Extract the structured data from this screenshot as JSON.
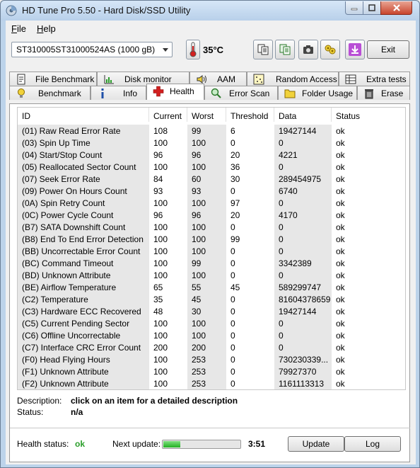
{
  "window": {
    "title": "HD Tune Pro 5.50 - Hard Disk/SSD Utility",
    "icon": "disk-app-icon"
  },
  "menu": [
    {
      "label": "File"
    },
    {
      "label": "Help"
    }
  ],
  "toolbar": {
    "drive": "ST310005ST31000524AS (1000 gB)",
    "temperature": "35",
    "temperature_unit": "°C",
    "buttons": [
      "copy-text-icon",
      "copy-info-icon",
      "screenshot-icon",
      "options-icon",
      "save-download-icon"
    ],
    "exit_label": "Exit"
  },
  "tabs_top": [
    {
      "label": "File Benchmark",
      "icon": "file-benchmark-icon"
    },
    {
      "label": "Disk monitor",
      "icon": "disk-monitor-icon"
    },
    {
      "label": "AAM",
      "icon": "speaker-icon"
    },
    {
      "label": "Random Access",
      "icon": "random-access-icon"
    },
    {
      "label": "Extra tests",
      "icon": "extra-tests-icon"
    }
  ],
  "tabs_bottom": [
    {
      "label": "Benchmark",
      "icon": "lightbulb-icon"
    },
    {
      "label": "Info",
      "icon": "info-icon"
    },
    {
      "label": "Health",
      "icon": "health-cross-icon"
    },
    {
      "label": "Error Scan",
      "icon": "magnifier-icon"
    },
    {
      "label": "Folder Usage",
      "icon": "folder-icon"
    },
    {
      "label": "Erase",
      "icon": "trash-icon"
    }
  ],
  "active_tab": "Health",
  "table": {
    "headers": [
      "ID",
      "Current",
      "Worst",
      "Threshold",
      "Data",
      "Status"
    ],
    "rows": [
      [
        "(01) Raw Read Error Rate",
        "108",
        "99",
        "6",
        "19427144",
        "ok"
      ],
      [
        "(03) Spin Up Time",
        "100",
        "100",
        "0",
        "0",
        "ok"
      ],
      [
        "(04) Start/Stop Count",
        "96",
        "96",
        "20",
        "4221",
        "ok"
      ],
      [
        "(05) Reallocated Sector Count",
        "100",
        "100",
        "36",
        "0",
        "ok"
      ],
      [
        "(07) Seek Error Rate",
        "84",
        "60",
        "30",
        "289454975",
        "ok"
      ],
      [
        "(09) Power On Hours Count",
        "93",
        "93",
        "0",
        "6740",
        "ok"
      ],
      [
        "(0A) Spin Retry Count",
        "100",
        "100",
        "97",
        "0",
        "ok"
      ],
      [
        "(0C) Power Cycle Count",
        "96",
        "96",
        "20",
        "4170",
        "ok"
      ],
      [
        "(B7) SATA Downshift Count",
        "100",
        "100",
        "0",
        "0",
        "ok"
      ],
      [
        "(B8) End To End Error Detection",
        "100",
        "100",
        "99",
        "0",
        "ok"
      ],
      [
        "(BB) Uncorrectable Error Count",
        "100",
        "100",
        "0",
        "0",
        "ok"
      ],
      [
        "(BC) Command Timeout",
        "100",
        "99",
        "0",
        "3342389",
        "ok"
      ],
      [
        "(BD) Unknown Attribute",
        "100",
        "100",
        "0",
        "0",
        "ok"
      ],
      [
        "(BE) Airflow Temperature",
        "65",
        "55",
        "45",
        "589299747",
        "ok"
      ],
      [
        "(C2) Temperature",
        "35",
        "45",
        "0",
        "81604378659",
        "ok"
      ],
      [
        "(C3) Hardware ECC Recovered",
        "48",
        "30",
        "0",
        "19427144",
        "ok"
      ],
      [
        "(C5) Current Pending Sector",
        "100",
        "100",
        "0",
        "0",
        "ok"
      ],
      [
        "(C6) Offline Uncorrectable",
        "100",
        "100",
        "0",
        "0",
        "ok"
      ],
      [
        "(C7) Interface CRC Error Count",
        "200",
        "200",
        "0",
        "0",
        "ok"
      ],
      [
        "(F0) Head Flying Hours",
        "100",
        "253",
        "0",
        "730230339...",
        "ok"
      ],
      [
        "(F1) Unknown Attribute",
        "100",
        "253",
        "0",
        "79927370",
        "ok"
      ],
      [
        "(F2) Unknown Attribute",
        "100",
        "253",
        "0",
        "1161113313",
        "ok"
      ]
    ]
  },
  "description": {
    "label": "Description:",
    "value": "click on an item for a detailed description",
    "status_label": "Status:",
    "status_value": "n/a"
  },
  "footer": {
    "health_label": "Health status:",
    "health_value": "ok",
    "next_update_label": "Next update:",
    "next_update_progress": 0.22,
    "next_update_time": "3:51",
    "update_label": "Update",
    "log_label": "Log"
  },
  "colors": {
    "ok_green": "#2a9e2a",
    "progress_green": "#22b022",
    "health_red": "#d21f1f",
    "purple_button": "#b94fd6"
  }
}
